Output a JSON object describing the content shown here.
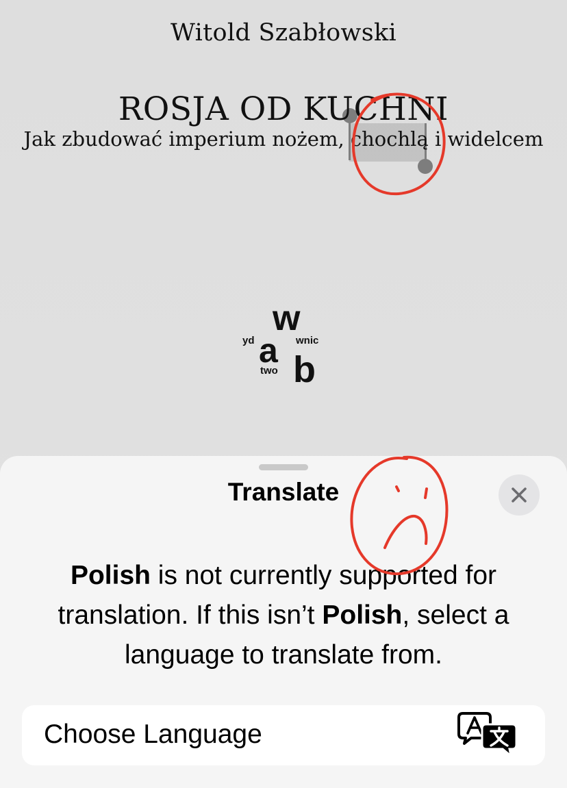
{
  "book": {
    "author": "Witold Szabłowski",
    "title": "ROSJA OD KUCHNI",
    "subtitle": "Jak zbudować imperium nożem, chochlą i widelcem",
    "selected_word": "chochlą"
  },
  "publisher_logo": {
    "letters": [
      "w",
      "a",
      "b"
    ],
    "fragments": [
      "yd",
      "wnic",
      "two"
    ]
  },
  "annotations": {
    "stroke_color": "#e5392a",
    "shapes": [
      "circle-around-selection",
      "sad-face"
    ]
  },
  "translate_sheet": {
    "title": "Translate",
    "close_icon": "xmark-icon",
    "message": {
      "language": "Polish",
      "part1": " is not currently supported for translation. If this isn’t ",
      "part2": ", select a language to translate from."
    },
    "choose_language_label": "Choose Language",
    "choose_language_icon": "translate-icon"
  },
  "colors": {
    "page_background": "#e0e0e0",
    "sheet_background": "#f5f5f5",
    "selection_highlight": "#a6a6a6"
  }
}
